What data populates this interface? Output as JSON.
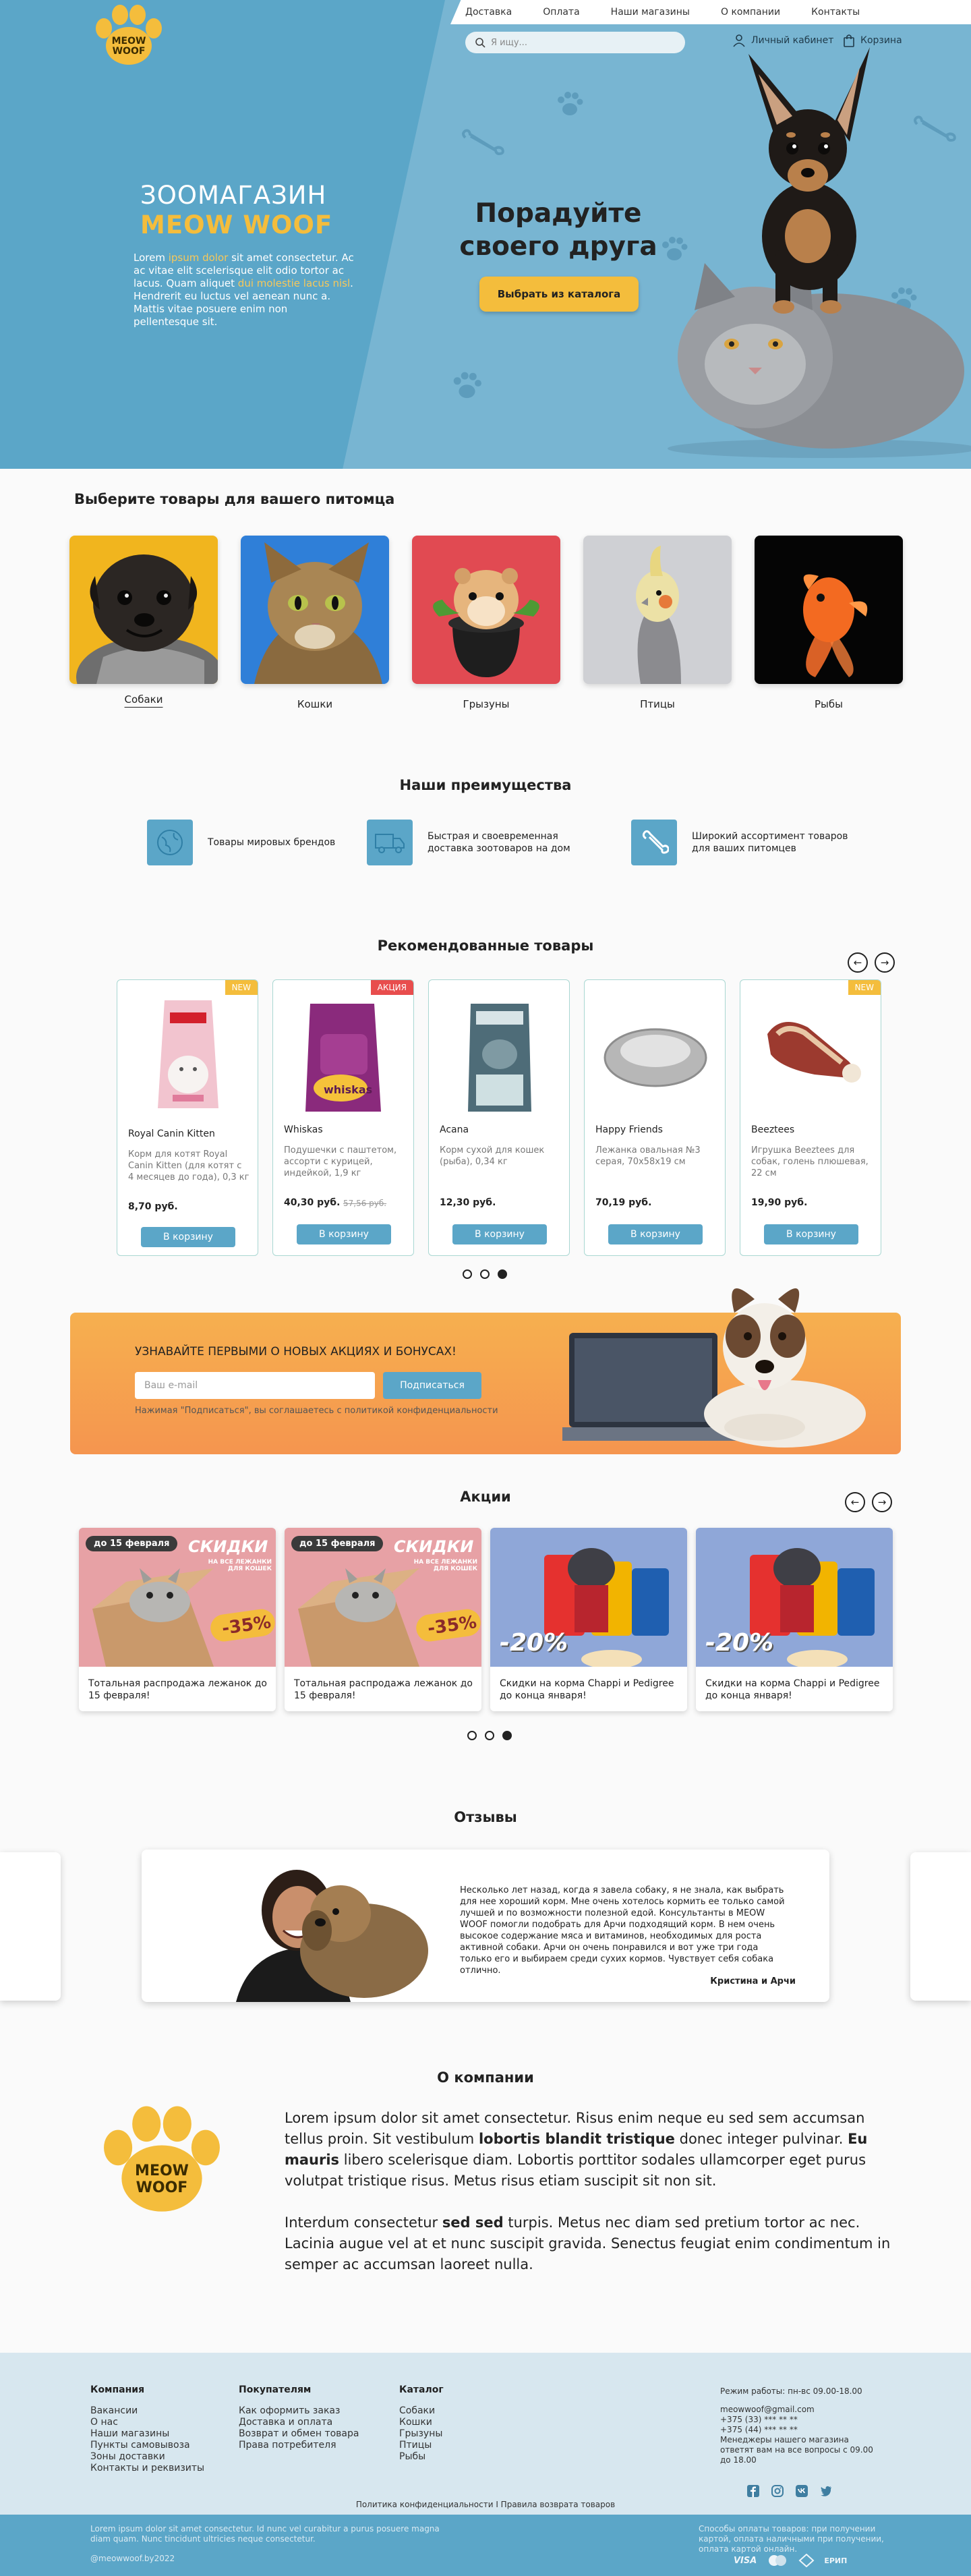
{
  "nav": {
    "links": [
      "Доставка",
      "Оплата",
      "Наши магазины",
      "О компании",
      "Контакты"
    ],
    "search_placeholder": "Я ищу...",
    "account": "Личный кабинет",
    "cart": "Корзина"
  },
  "logo": {
    "line1": "MEOW",
    "line2": "WOOF"
  },
  "hero": {
    "subtitle": "ЗООМАГАЗИН",
    "title": "MEOW WOOF",
    "text_parts": [
      "Lorem ",
      "ipsum dolor",
      " sit amet consectetur. Ac ac vitae elit scelerisque elit odio tortor ac lacus. Quam aliquet ",
      "dui molestie lacus nisl",
      ". Hendrerit eu luctus vel aenean nunc a. Mattis vitae posuere enim non pellentesque sit."
    ],
    "headline": "Порадуйте своего друга",
    "cta": "Выбрать из каталога"
  },
  "categories": {
    "title_plain": "Выберите товары ",
    "title_bold": "для вашего питомца",
    "items": [
      "Собаки",
      "Кошки",
      "Грызуны",
      "Птицы",
      "Рыбы"
    ]
  },
  "advantages": {
    "title": "Наши преимущества",
    "items": [
      {
        "icon": "globe-icon",
        "text": "Товары мировых брендов"
      },
      {
        "icon": "truck-icon",
        "text": "Быстрая и своевременная доставка зоотоваров на дом"
      },
      {
        "icon": "bone-icon",
        "text": "Широкий ассортимент товаров для ваших питомцев"
      }
    ]
  },
  "recommended": {
    "title": "Рекомендованные товары",
    "cart_label": "В корзину",
    "products": [
      {
        "badge": "NEW",
        "badge_color": "#f4bd3c",
        "name": "Royal Canin Kitten",
        "desc": "Корм для котят Royal Canin Kitten (для котят с 4 месяцев до года), 0,3 кг",
        "price": "8,70 руб.",
        "old": ""
      },
      {
        "badge": "АКЦИЯ",
        "badge_color": "#e84d4d",
        "name": "Whiskas",
        "desc": "Подушечки с паштетом, ассорти с курицей, индейкой, 1,9 кг",
        "price": "40,30 руб.",
        "old": "57,56 руб."
      },
      {
        "badge": "",
        "badge_color": "",
        "name": "Acana",
        "desc": "Корм сухой для кошек (рыба), 0,34 кг",
        "price": "12,30 руб.",
        "old": ""
      },
      {
        "badge": "",
        "badge_color": "",
        "name": "Happy Friends",
        "desc": "Лежанка овальная №3 серая, 70х58х19 см",
        "price": "70,19 руб.",
        "old": ""
      },
      {
        "badge": "NEW",
        "badge_color": "#f4bd3c",
        "name": "Beeztees",
        "desc": "Игрушка Beeztees для собак, голень плюшевая, 22 см",
        "price": "19,90 руб.",
        "old": ""
      }
    ]
  },
  "promo": {
    "title": "УЗНАВАЙТЕ ПЕРВЫМИ О НОВЫХ АКЦИЯХ И БОНУСАХ!",
    "email_placeholder": "Ваш e-mail",
    "button": "Подписаться",
    "note": "Нажимая \"Подписаться\", вы соглашаетесь с политикой конфиденциальности"
  },
  "sales": {
    "title": "Акции",
    "items": [
      {
        "tag": "до 15 февраля",
        "banner": "СКИДКИ",
        "banner_sub": "НА ВСЕ ЛЕЖАНКИ ДЛЯ КОШЕК",
        "pct": "-35%",
        "text": "Тотальная распродажа лежанок до 15 февраля!",
        "kind": "bed"
      },
      {
        "tag": "до 15 февраля",
        "banner": "СКИДКИ",
        "banner_sub": "НА ВСЕ ЛЕЖАНКИ ДЛЯ КОШЕК",
        "pct": "-35%",
        "text": "Тотальная распродажа лежанок до 15 февраля!",
        "kind": "bed"
      },
      {
        "tag": "",
        "banner": "",
        "banner_sub": "",
        "pct": "-20%",
        "text": "Скидки на корма Chappi и Pedigree до конца января!",
        "kind": "food"
      },
      {
        "tag": "",
        "banner": "",
        "banner_sub": "",
        "pct": "-20%",
        "text": "Скидки на корма Chappi и Pedigree до конца января!",
        "kind": "food"
      }
    ]
  },
  "reviews": {
    "title": "Отзывы",
    "text": "Несколько лет назад, когда я завела собаку, я не знала, как выбрать для нее хороший корм. Мне очень хотелось кормить ее только самой лучшей и по возможности полезной едой. Консультанты в MEOW WOOF помогли подобрать для Арчи подходящий корм. В нем очень высокое содержание мяса и витаминов, необходимых для роста активной собаки. Арчи он очень понравился и вот уже три года только его и выбираем среди сухих кормов. Чувствует себя собака отлично.",
    "author": "Кристина и Арчи"
  },
  "about": {
    "title": "О компании",
    "p1": [
      {
        "t": "Lorem ipsum dolor sit amet consectetur. Risus enim neque eu sed sem accumsan tellus proin. Sit vestibulum ",
        "b": false
      },
      {
        "t": "lobortis blandit tristique",
        "b": true
      },
      {
        "t": " donec integer pulvinar. ",
        "b": false
      },
      {
        "t": "Eu mauris",
        "b": true
      },
      {
        "t": " libero scelerisque diam. Lobortis porttitor sodales ullamcorper eget purus volutpat tristique risus. Metus risus etiam suscipit sit non sit.",
        "b": false
      }
    ],
    "p2": [
      {
        "t": "Interdum consectetur ",
        "b": false
      },
      {
        "t": "sed sed",
        "b": true
      },
      {
        "t": " turpis. Metus nec diam sed pretium tortor ac nec. Lacinia augue vel at et nunc suscipit gravida. Senectus feugiat enim condimentum in semper ac accumsan laoreet nulla.",
        "b": false
      }
    ]
  },
  "footer": {
    "cols": [
      {
        "title": "Компания",
        "links": [
          "Вакансии",
          "О нас",
          "Наши магазины",
          "Пункты самовывоза",
          "Зоны доставки",
          "Контакты и реквизиты"
        ]
      },
      {
        "title": "Покупателям",
        "links": [
          "Как оформить заказ",
          "Доставка и оплата",
          "Возврат и обмен товара",
          "Права потребителя"
        ]
      },
      {
        "title": "Каталог",
        "links": [
          "Собаки",
          "Кошки",
          "Грызуны",
          "Птицы",
          "Рыбы"
        ]
      }
    ],
    "hours": "Режим работы: пн-вс 09.00-18.00",
    "email": "meowwoof@gmail.com",
    "phone1": "+375 (33) *** ** **",
    "phone2": "+375 (44) *** ** **",
    "callback": "Менеджеры нашего магазина ответят вам на все вопросы с 09.00 до 18.00",
    "policy": "Политика конфиденциальности I Правила возврата товаров",
    "legal": "Lorem ipsum dolor sit amet consectetur. Id nunc vel curabitur a purus posuere magna diam quam. Nunc tincidunt ultricies neque consectetur.",
    "copyright": "@meowwoof.by2022",
    "payments_text": "Способы оплаты товаров: при получении картой, оплата наличными при получении, оплата картой онлайн.",
    "payments": [
      "VISA",
      "Mastercard",
      "Белкарт",
      "ЕРИП"
    ]
  }
}
